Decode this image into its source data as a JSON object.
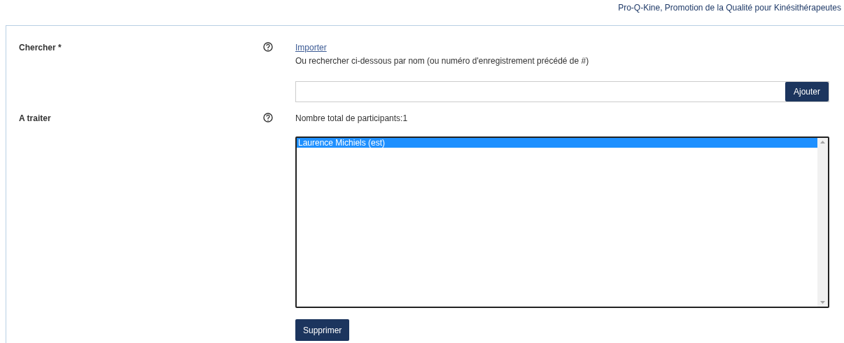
{
  "header": {
    "title": "Pro-Q-Kine, Promotion de la Qualité pour Kinésithérapeutes"
  },
  "search": {
    "label": "Chercher *",
    "import_link": "Importer",
    "hint": "Ou rechercher ci-dessous par nom (ou numéro d'enregistrement précédé de #)",
    "add_button": "Ajouter"
  },
  "to_process": {
    "label": "A traiter",
    "count": "Nombre total de participants:1",
    "items": [
      {
        "name": "Laurence Michiels (est)",
        "selected": true
      }
    ],
    "delete_button": "Supprimer"
  }
}
